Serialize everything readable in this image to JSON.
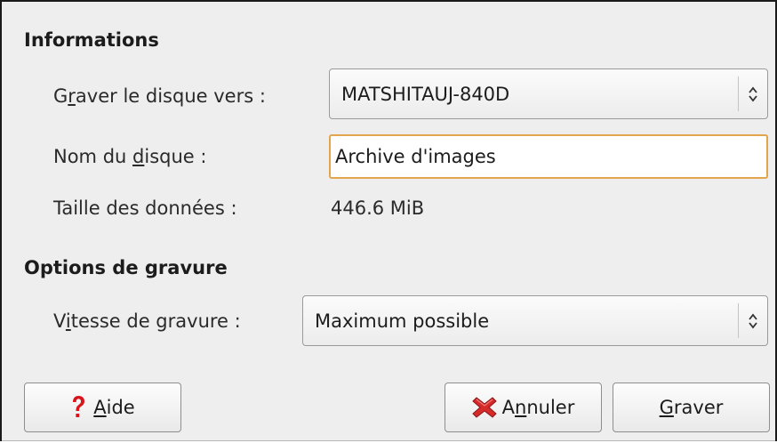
{
  "informations": {
    "title": "Informations",
    "graver_label_prefix": "G",
    "graver_label_mnemonic": "r",
    "graver_label_suffix": "aver le disque vers :",
    "device_value": "MATSHITAUJ-840D",
    "nom_label_prefix": "Nom du ",
    "nom_label_mnemonic": "d",
    "nom_label_suffix": "isque :",
    "disc_name_value": "Archive d'images",
    "taille_label": "Taille des données :",
    "taille_value": "446.6 MiB"
  },
  "options": {
    "title": "Options de gravure",
    "vitesse_label_prefix": "V",
    "vitesse_label_mnemonic": "i",
    "vitesse_label_suffix": "tesse de gravure :",
    "speed_value": "Maximum possible"
  },
  "buttons": {
    "aide_mnemonic": "A",
    "aide_rest": "ide",
    "annuler_prefix": "A",
    "annuler_mnemonic": "n",
    "annuler_suffix": "nuler",
    "graver_mnemonic": "G",
    "graver_rest": "raver"
  },
  "icons": {
    "help": "question-mark-icon",
    "cancel": "red-x-icon",
    "updown": "up-down-arrows-icon"
  },
  "colors": {
    "dialog_bg": "#eeeeee",
    "focus_border": "#e3a54c",
    "help_red": "#d8141c",
    "cancel_red": "#d62a2a"
  }
}
